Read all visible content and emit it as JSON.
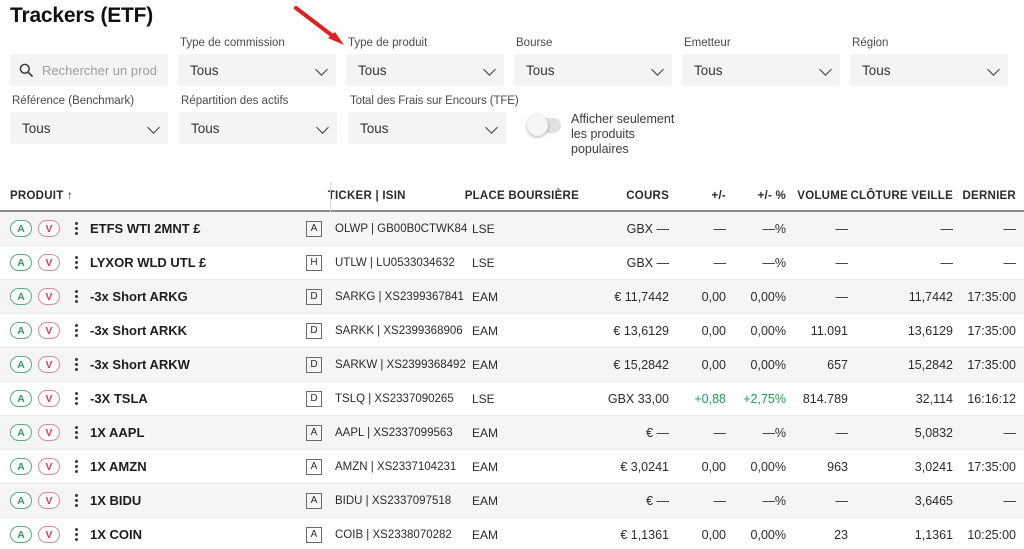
{
  "page_title": "Trackers (ETF)",
  "search": {
    "placeholder": "Rechercher un produit",
    "value": "",
    "icon": "search-icon"
  },
  "filters": [
    {
      "label": "Type de commission",
      "value": "Tous"
    },
    {
      "label": "Type de produit",
      "value": "Tous"
    },
    {
      "label": "Bourse",
      "value": "Tous"
    },
    {
      "label": "Emetteur",
      "value": "Tous"
    },
    {
      "label": "Région",
      "value": "Tous"
    },
    {
      "label": "Référence (Benchmark)",
      "value": "Tous"
    },
    {
      "label": "Répartition des actifs",
      "value": "Tous"
    },
    {
      "label": "Total des Frais sur Encours (TFE)",
      "value": "Tous"
    }
  ],
  "popular_toggle": {
    "label": "Afficher seulement les produits populaires",
    "state": "off"
  },
  "table": {
    "headers": {
      "product": "PRODUIT",
      "sort_indicator": "↑",
      "ticker": "TICKER | ISIN",
      "place": "PLACE BOURSIÈRE",
      "cours": "COURS",
      "change": "+/-",
      "change_pct": "+/- %",
      "volume": "VOLUME",
      "close": "CLÔTURE VEILLE",
      "last": "DERNIER"
    },
    "buy_label": "A",
    "sell_label": "V",
    "rows": [
      {
        "product": "ETFS WTI 2MNT £",
        "flag": "A",
        "ticker": "OLWP | GB00B0CTWK84",
        "place": "LSE",
        "cours": "GBX —",
        "change": "—",
        "change_pct": "—%",
        "volume": "—",
        "close": "—",
        "last": "—",
        "dir": "none"
      },
      {
        "product": "LYXOR WLD UTL £",
        "flag": "H",
        "ticker": "UTLW | LU0533034632",
        "place": "LSE",
        "cours": "GBX —",
        "change": "—",
        "change_pct": "—%",
        "volume": "—",
        "close": "—",
        "last": "—",
        "dir": "none"
      },
      {
        "product": "-3x Short ARKG",
        "flag": "D",
        "ticker": "SARKG | XS2399367841",
        "place": "EAM",
        "cours": "€ 11,7442",
        "change": "0,00",
        "change_pct": "0,00%",
        "volume": "—",
        "close": "11,7442",
        "last": "17:35:00",
        "dir": "none"
      },
      {
        "product": "-3x Short ARKK",
        "flag": "D",
        "ticker": "SARKK | XS2399368906",
        "place": "EAM",
        "cours": "€ 13,6129",
        "change": "0,00",
        "change_pct": "0,00%",
        "volume": "11.091",
        "close": "13,6129",
        "last": "17:35:00",
        "dir": "none"
      },
      {
        "product": "-3x Short ARKW",
        "flag": "D",
        "ticker": "SARKW | XS2399368492",
        "place": "EAM",
        "cours": "€ 15,2842",
        "change": "0,00",
        "change_pct": "0,00%",
        "volume": "657",
        "close": "15,2842",
        "last": "17:35:00",
        "dir": "none"
      },
      {
        "product": "-3X TSLA",
        "flag": "D",
        "ticker": "TSLQ | XS2337090265",
        "place": "LSE",
        "cours": "GBX 33,00",
        "change": "+0,88",
        "change_pct": "+2,75%",
        "volume": "814.789",
        "close": "32,114",
        "last": "16:16:12",
        "dir": "up"
      },
      {
        "product": "1X AAPL",
        "flag": "A",
        "ticker": "AAPL | XS2337099563",
        "place": "EAM",
        "cours": "€ —",
        "change": "—",
        "change_pct": "—%",
        "volume": "—",
        "close": "5,0832",
        "last": "—",
        "dir": "none"
      },
      {
        "product": "1X AMZN",
        "flag": "A",
        "ticker": "AMZN | XS2337104231",
        "place": "EAM",
        "cours": "€ 3,0241",
        "change": "0,00",
        "change_pct": "0,00%",
        "volume": "963",
        "close": "3,0241",
        "last": "17:35:00",
        "dir": "none"
      },
      {
        "product": "1X BIDU",
        "flag": "A",
        "ticker": "BIDU | XS2337097518",
        "place": "EAM",
        "cours": "€ —",
        "change": "—",
        "change_pct": "—%",
        "volume": "—",
        "close": "3,6465",
        "last": "—",
        "dir": "none"
      },
      {
        "product": "1X COIN",
        "flag": "A",
        "ticker": "COIB | XS2338070282",
        "place": "EAM",
        "cours": "€ 1,1361",
        "change": "0,00",
        "change_pct": "0,00%",
        "volume": "23",
        "close": "1,1361",
        "last": "10:25:00",
        "dir": "none"
      }
    ]
  },
  "annotation": {
    "type": "red-arrow",
    "color": "#e02020",
    "points_to": "Type de produit"
  },
  "colors": {
    "positive": "#1a9e51",
    "buy": "#2e9e5b",
    "sell": "#d0414f",
    "row_alt": "#f5f5f5"
  }
}
